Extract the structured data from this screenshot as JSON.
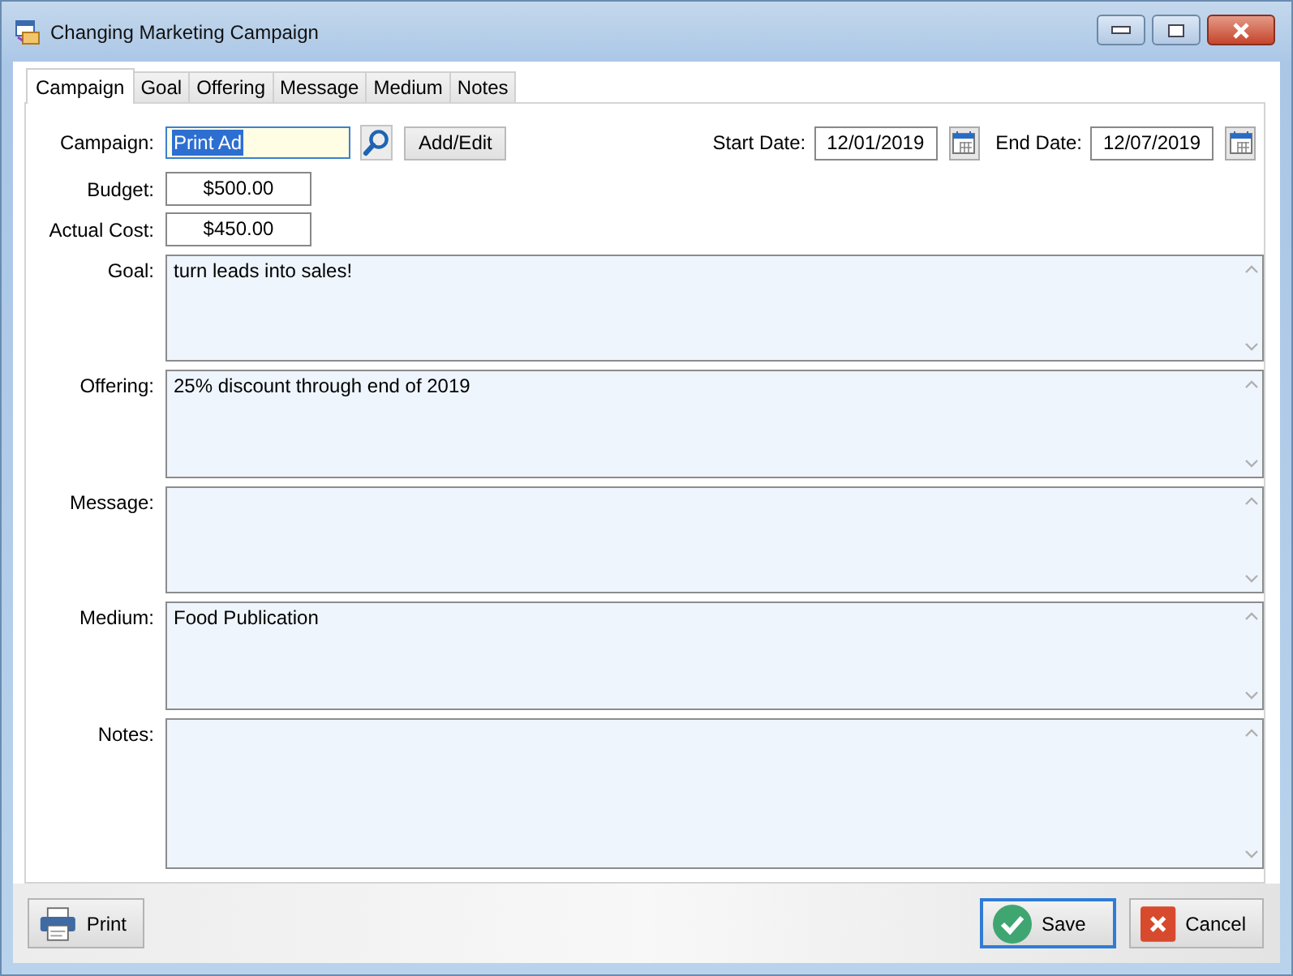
{
  "window": {
    "title": "Changing Marketing Campaign"
  },
  "tabs": [
    {
      "label": "Campaign",
      "selected": true
    },
    {
      "label": "Goal",
      "selected": false
    },
    {
      "label": "Offering",
      "selected": false
    },
    {
      "label": "Message",
      "selected": false
    },
    {
      "label": "Medium",
      "selected": false
    },
    {
      "label": "Notes",
      "selected": false
    }
  ],
  "campaign": {
    "label": "Campaign:",
    "value": "Print Ad",
    "selected": true,
    "add_button": "Add/Edit"
  },
  "dates": [
    {
      "label": "Start Date:",
      "value": "12/01/2019"
    },
    {
      "label": "End Date:",
      "value": "12/07/2019"
    }
  ],
  "amounts": [
    {
      "label": "Budget:",
      "value": "$500.00"
    },
    {
      "label": "Actual Cost:",
      "value": "$450.00"
    }
  ],
  "memos": [
    {
      "label": "Goal:",
      "value": "turn leads into sales!"
    },
    {
      "label": "Offering:",
      "value": "25% discount through end of 2019"
    },
    {
      "label": "Message:"
    },
    {
      "label": "Medium:",
      "value": "Food Publication"
    },
    {
      "label": "Notes:"
    }
  ],
  "buttons": [
    {
      "label": "Print",
      "kind": "print"
    },
    {
      "label": "Save",
      "kind": "save",
      "focused": true
    },
    {
      "label": "Cancel",
      "kind": "cancel",
      "focused": false
    }
  ]
}
